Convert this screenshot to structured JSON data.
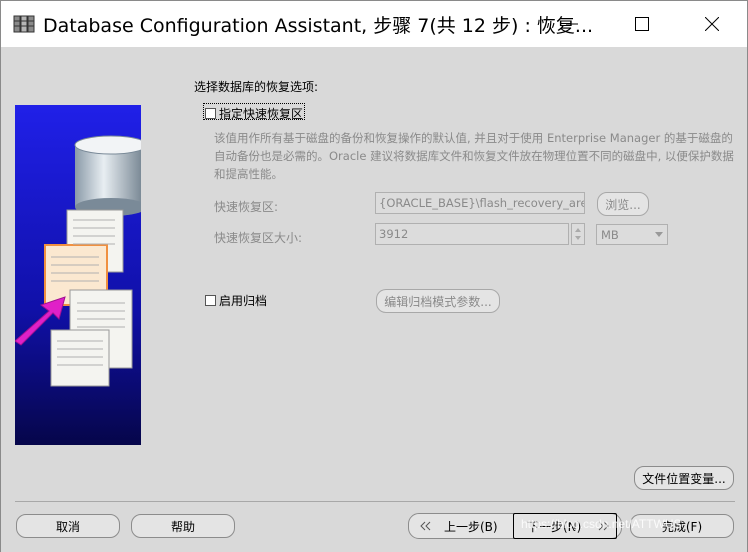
{
  "window": {
    "title": "Database Configuration Assistant, 步骤 7(共 12 步) : 恢复..."
  },
  "main": {
    "section_title": "选择数据库的恢复选项:",
    "flash_recovery": {
      "checkbox_label": "指定快速恢复区",
      "checked": false,
      "description": "该值用作所有基于磁盘的备份和恢复操作的默认值, 并且对于使用 Enterprise Manager 的基于磁盘的自动备份也是必需的。Oracle 建议将数据库文件和恢复文件放在物理位置不同的磁盘中, 以便保护数据和提高性能。",
      "area_label": "快速恢复区:",
      "area_value": "{ORACLE_BASE}\\flash_recovery_area",
      "browse_label": "浏览...",
      "size_label": "快速恢复区大小:",
      "size_value": "3912",
      "unit_value": "MB"
    },
    "archive": {
      "checkbox_label": "启用归档",
      "checked": false,
      "edit_params_label": "编辑归档模式参数..."
    },
    "file_location_label": "文件位置变量..."
  },
  "footer": {
    "cancel_label": "取消",
    "help_label": "帮助",
    "back_label": "上一步(B)",
    "next_label": "下一步(N)",
    "finish_label": "完成(F)",
    "watermark": "https://blog.csdn.net/ATTWUS"
  },
  "colors": {
    "dialog_bg": "#d9d9d9",
    "disabled_text": "#8a8a8a",
    "side_panel_blue": "#1a1ad0"
  }
}
